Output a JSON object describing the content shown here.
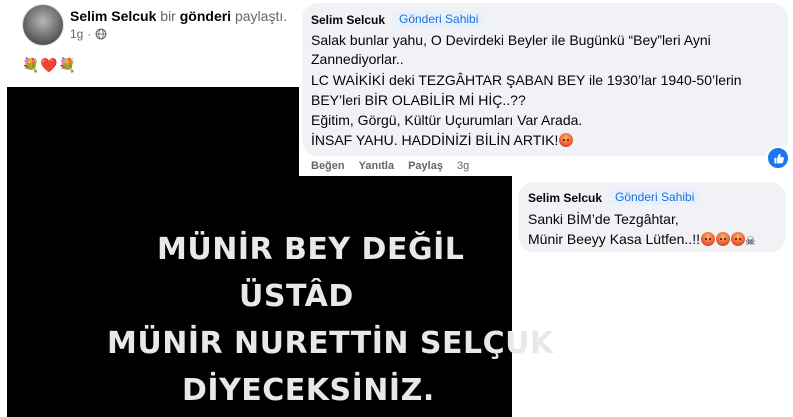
{
  "post": {
    "author": "Selim Selcuk",
    "text_bir": "bir",
    "text_gonderi": "gönderi",
    "text_paylasti": "paylaştı.",
    "time": "1g",
    "separator": "·",
    "emojis": "💐❤️💐",
    "image_lines": [
      "MÜNİR BEY DEĞİL",
      "ÜSTÂD",
      "MÜNİR NURETTİN SELÇUK",
      "DİYECEKSİNİZ."
    ]
  },
  "comment1": {
    "author": "Selim Selcuk",
    "badge": "Gönderi Sahibi",
    "lines": [
      "Salak bunlar yahu, O Devirdeki Beyler ile Bugünkü “Bey”leri Ayni",
      "Zannediyorlar..",
      "LC WAİKİKİ deki TEZGÂHTAR ŞABAN BEY ile 1930’lar 1940-50’lerin",
      "BEY’leri BİR OLABİLİR Mİ HİÇ..??",
      "Eğitim, Görgü, Kültür Uçurumları Var Arada.",
      "İNSAF YAHU. HADDİNİZİ BİLİN ARTIK!"
    ],
    "actions": {
      "like": "Beğen",
      "reply": "Yanıtla",
      "share": "Paylaş",
      "time": "3g"
    }
  },
  "comment2": {
    "author": "Selim Selcuk",
    "badge": "Gönderi Sahibi",
    "line1": "Sanki BİM’de Tezgâhtar,",
    "line2": "Münir Beeyy Kasa Lütfen..!!"
  },
  "colors": {
    "bubble": "#f0f2f5",
    "badge_text": "#1c6fe0",
    "like_blue": "#1877f2",
    "muted": "#65676b"
  }
}
